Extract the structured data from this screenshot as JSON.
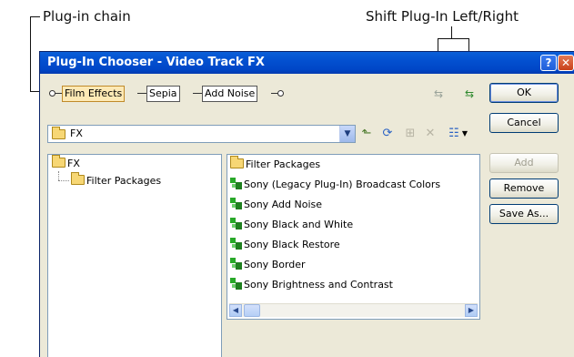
{
  "callouts": {
    "plugin_chain": "Plug-in chain",
    "shift": "Shift Plug-In Left/Right"
  },
  "window": {
    "title": "Plug-In Chooser - Video Track FX",
    "help_icon": "?",
    "close_icon": "✕"
  },
  "chain": {
    "nodes": [
      "Film Effects",
      "Sepia",
      "Add Noise"
    ],
    "selected": "Film Effects"
  },
  "buttons": {
    "ok": "OK",
    "cancel": "Cancel",
    "add": "Add",
    "remove": "Remove",
    "save_as": "Save As..."
  },
  "location": {
    "value": "FX"
  },
  "tree": {
    "root": "FX",
    "child": "Filter Packages"
  },
  "list": {
    "items": [
      {
        "label": "Filter Packages",
        "icon": "folder-icon"
      },
      {
        "label": "Sony (Legacy Plug-In) Broadcast Colors",
        "icon": "plugin-icon"
      },
      {
        "label": "Sony Add Noise",
        "icon": "plugin-icon"
      },
      {
        "label": "Sony Black and White",
        "icon": "plugin-icon"
      },
      {
        "label": "Sony Black Restore",
        "icon": "plugin-icon"
      },
      {
        "label": "Sony Border",
        "icon": "plugin-icon"
      },
      {
        "label": "Sony Brightness and Contrast",
        "icon": "plugin-icon"
      }
    ]
  },
  "colors": {
    "titlebar": "#0046c7",
    "dialog_bg": "#ece9d8",
    "selected_node": "#fde9b5"
  }
}
